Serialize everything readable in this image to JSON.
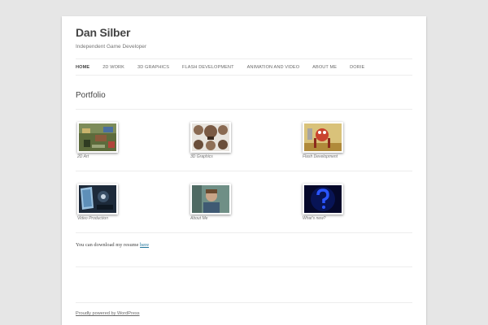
{
  "site": {
    "title": "Dan Silber",
    "description": "Independent Game Developer"
  },
  "nav": {
    "items": [
      {
        "label": "HOME",
        "current": true
      },
      {
        "label": "2D WORK"
      },
      {
        "label": "3D GRAPHICS"
      },
      {
        "label": "FLASH DEVELOPMENT"
      },
      {
        "label": "ANIMATION AND VIDEO"
      },
      {
        "label": "ABOUT ME"
      },
      {
        "label": "DORIE"
      }
    ]
  },
  "page": {
    "title": "Portfolio"
  },
  "gallery": {
    "items": [
      {
        "caption": "2D Art"
      },
      {
        "caption": "3D Graphics"
      },
      {
        "caption": "Flash Development"
      },
      {
        "caption": "Video Production"
      },
      {
        "caption": "About Me"
      },
      {
        "caption": "What's new?"
      }
    ]
  },
  "resume": {
    "text": "You can download my resume ",
    "link": "here"
  },
  "footer": {
    "credit": "Proudly powered by WordPress"
  }
}
